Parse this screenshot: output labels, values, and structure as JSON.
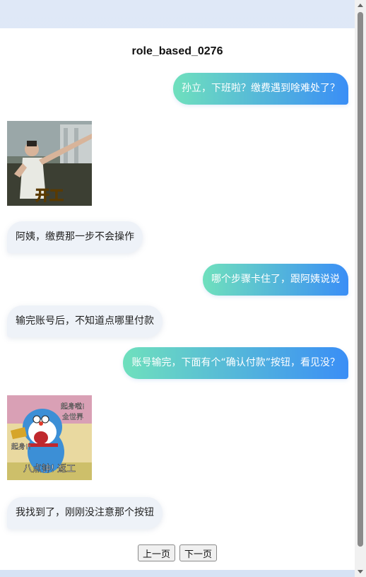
{
  "chat": {
    "title": "role_based_0276",
    "messages": [
      {
        "type": "text",
        "side": "out",
        "text": "孙立，下班啦？缴费遇到啥难处了？"
      },
      {
        "type": "sticker",
        "side": "in",
        "text": "开工"
      },
      {
        "type": "text",
        "side": "in",
        "text": "阿姨，缴费那一步不会操作"
      },
      {
        "type": "text",
        "side": "out",
        "text": "哪个步骤卡住了，跟阿姨说说"
      },
      {
        "type": "text",
        "side": "in",
        "text": "输完账号后，不知道点哪里付款"
      },
      {
        "type": "text",
        "side": "out",
        "text": "账号输完，下面有个“确认付款”按钮，看见没？"
      },
      {
        "type": "sticker",
        "side": "in",
        "lines": [
          "起身啦!",
          "全世界",
          "起身!!",
          "八点钟! 返工"
        ]
      },
      {
        "type": "text",
        "side": "in",
        "text": "我找到了，刚刚没注意那个按钮"
      }
    ]
  },
  "pager": {
    "prev_label": "上一页",
    "next_label": "下一页"
  }
}
